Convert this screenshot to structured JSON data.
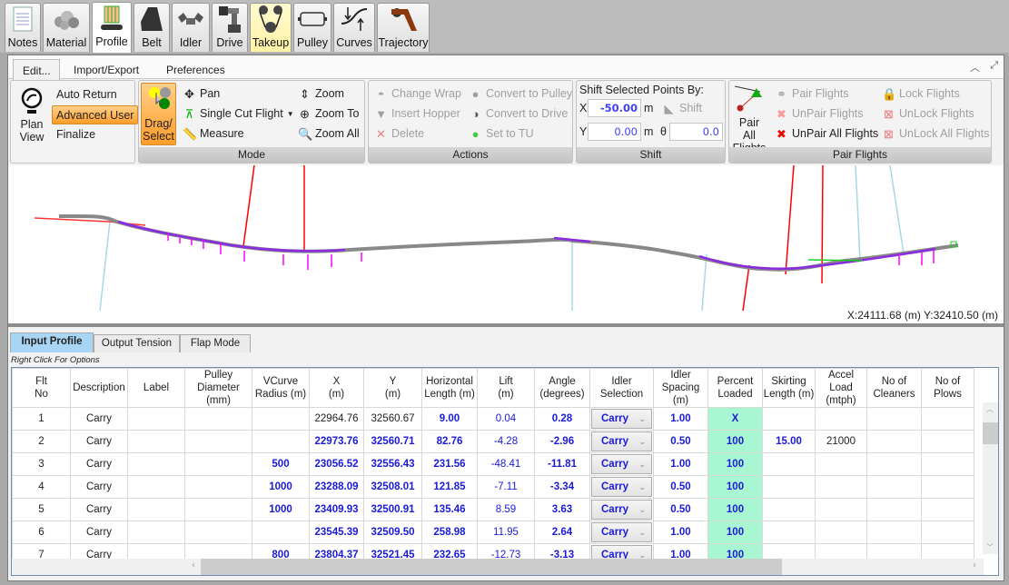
{
  "top_tabs": [
    {
      "label": "Notes",
      "icon": "notes-icon"
    },
    {
      "label": "Material",
      "icon": "material-icon"
    },
    {
      "label": "Profile",
      "icon": "profile-icon",
      "active": true
    },
    {
      "label": "Belt",
      "icon": "belt-icon"
    },
    {
      "label": "Idler",
      "icon": "idler-icon"
    },
    {
      "label": "Drive",
      "icon": "drive-icon"
    },
    {
      "label": "Takeup",
      "icon": "takeup-icon",
      "highlighted": true
    },
    {
      "label": "Pulley",
      "icon": "pulley-icon"
    },
    {
      "label": "Curves",
      "icon": "curves-icon"
    },
    {
      "label": "Trajectory",
      "icon": "trajectory-icon"
    }
  ],
  "ribbon_tabs": [
    "Edit...",
    "Import/Export",
    "Preferences"
  ],
  "ribbon": {
    "view_group": {
      "plan_view": "Plan View",
      "auto_return": "Auto Return",
      "advanced_user": "Advanced User",
      "finalize": "Finalize"
    },
    "mode_group": {
      "caption": "Mode",
      "drag_select": "Drag/ Select",
      "pan": "Pan",
      "single_cut_flight": "Single Cut Flight",
      "measure": "Measure",
      "zoom": "Zoom",
      "zoom_to": "Zoom To",
      "zoom_all": "Zoom All"
    },
    "actions_group": {
      "caption": "Actions",
      "change_wrap": "Change Wrap",
      "insert_hopper": "Insert Hopper",
      "delete": "Delete",
      "convert_to_pulley": "Convert to Pulley",
      "convert_to_drive": "Convert to Drive",
      "set_to_tu": "Set to TU"
    },
    "shift_group": {
      "caption": "Shift",
      "title": "Shift Selected Points By:",
      "x_label": "X",
      "x_value": "-50.00",
      "y_label": "Y",
      "y_value": "0.00",
      "unit": "m",
      "theta_label": "θ",
      "theta_value": "0.0",
      "shift_button": "Shift"
    },
    "pair_group": {
      "caption": "Pair Flights",
      "pair_all": "Pair All Flights",
      "pair_flights": "Pair Flights",
      "unpair_flights": "UnPair Flights",
      "unpair_all": "UnPair All Flights",
      "lock_flights": "Lock Flights",
      "unlock_flights": "UnLock Flights",
      "unlock_all": "UnLock All Flights"
    }
  },
  "canvas": {
    "coordinate_readout": "X:24111.68 (m) Y:32410.50 (m)"
  },
  "bottom_tabs": [
    "Input Profile",
    "Output Tension",
    "Flap Mode"
  ],
  "grid_hint": "Right Click For Options",
  "columns": [
    "Flt No",
    "Description",
    "Label",
    "Pulley Diameter (mm)",
    "VCurve Radius (m)",
    "X (m)",
    "Y (m)",
    "Horizontal Length (m)",
    "Lift (m)",
    "Angle (degrees)",
    "Idler Selection",
    "Idler Spacing (m)",
    "Percent Loaded",
    "Skirting Length (m)",
    "Accel Load (mtph)",
    "No of Cleaners",
    "No of Plows"
  ],
  "column_headers": [
    [
      "Flt",
      "No"
    ],
    [
      "Description",
      ""
    ],
    [
      "Label",
      ""
    ],
    [
      "Pulley",
      "Diameter (mm)"
    ],
    [
      "VCurve",
      "Radius (m)"
    ],
    [
      "X",
      "(m)"
    ],
    [
      "Y",
      "(m)"
    ],
    [
      "Horizontal",
      "Length (m)"
    ],
    [
      "Lift",
      "(m)"
    ],
    [
      "Angle",
      "(degrees)"
    ],
    [
      "Idler Selection",
      ""
    ],
    [
      "Idler",
      "Spacing (m)"
    ],
    [
      "Percent",
      "Loaded"
    ],
    [
      "Skirting",
      "Length (m)"
    ],
    [
      "Accel Load",
      "(mtph)"
    ],
    [
      "No of",
      "Cleaners"
    ],
    [
      "No of",
      "Plows"
    ]
  ],
  "rows": [
    {
      "flt": "1",
      "desc": "Carry",
      "label": "",
      "pulley": "",
      "vcurve": "",
      "x": "22964.76",
      "y": "32560.67",
      "hlen": "9.00",
      "lift": "0.04",
      "angle": "0.28",
      "idler": "Carry",
      "spacing": "1.00",
      "loaded": "X",
      "skirt": "",
      "accel": "",
      "cleaners": "",
      "plows": ""
    },
    {
      "flt": "2",
      "desc": "Carry",
      "label": "",
      "pulley": "",
      "vcurve": "",
      "x": "22973.76",
      "y": "32560.71",
      "hlen": "82.76",
      "lift": "-4.28",
      "angle": "-2.96",
      "idler": "Carry",
      "spacing": "0.50",
      "loaded": "100",
      "skirt": "15.00",
      "accel": "21000",
      "cleaners": "",
      "plows": ""
    },
    {
      "flt": "3",
      "desc": "Carry",
      "label": "",
      "pulley": "",
      "vcurve": "500",
      "x": "23056.52",
      "y": "32556.43",
      "hlen": "231.56",
      "lift": "-48.41",
      "angle": "-11.81",
      "idler": "Carry",
      "spacing": "1.00",
      "loaded": "100",
      "skirt": "",
      "accel": "",
      "cleaners": "",
      "plows": ""
    },
    {
      "flt": "4",
      "desc": "Carry",
      "label": "",
      "pulley": "",
      "vcurve": "1000",
      "x": "23288.09",
      "y": "32508.01",
      "hlen": "121.85",
      "lift": "-7.11",
      "angle": "-3.34",
      "idler": "Carry",
      "spacing": "0.50",
      "loaded": "100",
      "skirt": "",
      "accel": "",
      "cleaners": "",
      "plows": ""
    },
    {
      "flt": "5",
      "desc": "Carry",
      "label": "",
      "pulley": "",
      "vcurve": "1000",
      "x": "23409.93",
      "y": "32500.91",
      "hlen": "135.46",
      "lift": "8.59",
      "angle": "3.63",
      "idler": "Carry",
      "spacing": "0.50",
      "loaded": "100",
      "skirt": "",
      "accel": "",
      "cleaners": "",
      "plows": ""
    },
    {
      "flt": "6",
      "desc": "Carry",
      "label": "",
      "pulley": "",
      "vcurve": "",
      "x": "23545.39",
      "y": "32509.50",
      "hlen": "258.98",
      "lift": "11.95",
      "angle": "2.64",
      "idler": "Carry",
      "spacing": "1.00",
      "loaded": "100",
      "skirt": "",
      "accel": "",
      "cleaners": "",
      "plows": ""
    },
    {
      "flt": "7",
      "desc": "Carry",
      "label": "",
      "pulley": "",
      "vcurve": "800",
      "x": "23804.37",
      "y": "32521.45",
      "hlen": "232.65",
      "lift": "-12.73",
      "angle": "-3.13",
      "idler": "Carry",
      "spacing": "1.00",
      "loaded": "100",
      "skirt": "",
      "accel": "",
      "cleaners": "",
      "plows": ""
    }
  ],
  "colors": {
    "accent_orange": "#ff9d2a",
    "active_tab_blue": "#a7d5f3",
    "percent_loaded_bg": "#a9f7d2",
    "value_blue": "#1a1ad8",
    "takeup_highlight": "#fff3a5"
  }
}
